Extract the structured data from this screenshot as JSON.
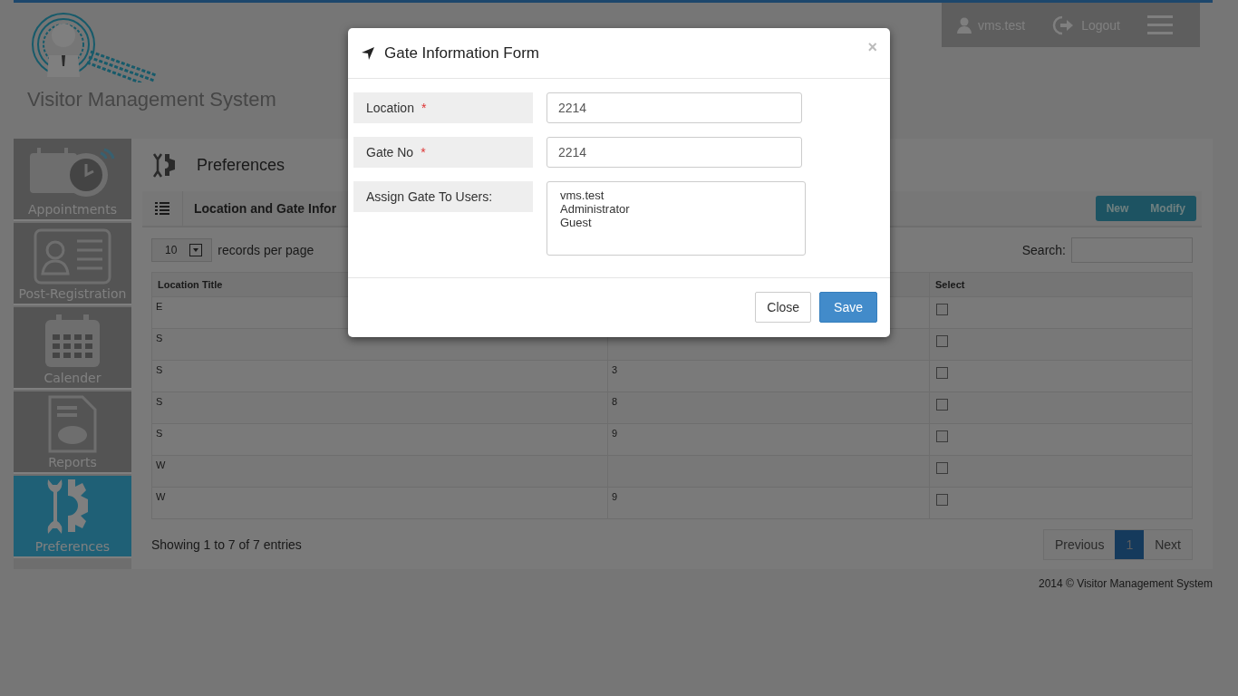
{
  "header": {
    "logo_text": "Visitor Management System",
    "user": "vms.test",
    "logout": "Logout"
  },
  "sidebar": {
    "items": [
      {
        "label": "Appointments",
        "selected": false
      },
      {
        "label": "Post-Registration",
        "selected": false
      },
      {
        "label": "Calender",
        "selected": false
      },
      {
        "label": "Reports",
        "selected": false
      },
      {
        "label": "Preferences",
        "selected": true
      }
    ]
  },
  "page": {
    "title": "Preferences",
    "panel_title": "Location and Gate Infor",
    "buttons": [
      "New",
      "Modify"
    ],
    "page_size": "10",
    "page_size_label": "records per page",
    "search_label": "Search:"
  },
  "table": {
    "columns": [
      "Location Title",
      "",
      "Select"
    ],
    "rows": [
      {
        "cells": [
          "E",
          ""
        ],
        "checked": false
      },
      {
        "cells": [
          "S",
          ""
        ],
        "checked": false
      },
      {
        "cells": [
          "S",
          "3"
        ],
        "checked": false
      },
      {
        "cells": [
          "S",
          "8"
        ],
        "checked": false
      },
      {
        "cells": [
          "S",
          "9"
        ],
        "checked": false
      },
      {
        "cells": [
          "W",
          ""
        ],
        "checked": false
      },
      {
        "cells": [
          "W",
          "9"
        ],
        "checked": false
      }
    ]
  },
  "pagination": {
    "info": "Showing 1 to 7 of 7 entries",
    "previous": "Previous",
    "pages": [
      {
        "label": "1",
        "selected": true
      }
    ],
    "next": "Next"
  },
  "footer": "2014 © Visitor Management System",
  "modal": {
    "title": "Gate Information Form",
    "close": "×",
    "fields": [
      {
        "kind": "text",
        "label": "Location",
        "required": true,
        "value": "2214"
      },
      {
        "kind": "text",
        "label": "Gate No",
        "required": true,
        "value": "2214"
      },
      {
        "kind": "list",
        "label": "Assign Gate To Users:",
        "required": false,
        "options": [
          "vms.test",
          "Administrator",
          "Guest"
        ]
      }
    ],
    "required_mark": "*",
    "buttons": [
      {
        "label": "Close",
        "kind": "default"
      },
      {
        "label": "Save",
        "kind": "primary"
      }
    ]
  }
}
